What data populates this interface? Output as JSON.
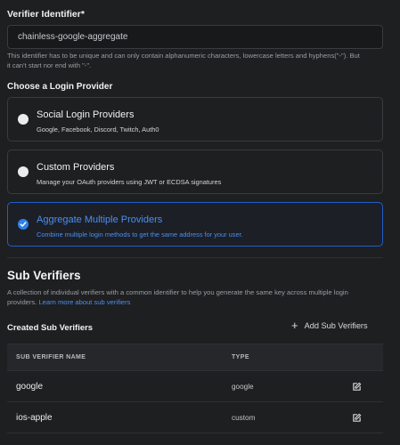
{
  "identifier": {
    "label": "Verifier Identifier*",
    "value": "chainless-google-aggregate",
    "help_line1": "This identifier has to be unique and can only contain alphanumeric characters, lowercase letters and hyphens(\"-\"). But",
    "help_line2": "it can't start nor end with \"-\"."
  },
  "login_provider": {
    "heading": "Choose a Login Provider",
    "options": [
      {
        "title": "Social Login Providers",
        "subtitle": "Google, Facebook, Discord, Twitch, Auth0",
        "selected": false
      },
      {
        "title": "Custom Providers",
        "subtitle": "Manage your OAuth providers using JWT or ECDSA signatures",
        "selected": false
      },
      {
        "title": "Aggregate Multiple Providers",
        "subtitle": "Combine multiple login methods to get the same address for your user.",
        "selected": true
      }
    ]
  },
  "sub_verifiers": {
    "title": "Sub Verifiers",
    "desc_line1": "A collection of individual verifiers with a common identifier to help you generate the same key across multiple login",
    "desc_line2_prefix": "providers. ",
    "learn_more": "Learn more about sub verifiers",
    "created_label": "Created Sub Verifiers",
    "add_label": "Add Sub Verifiers",
    "columns": [
      "SUB VERIFIER NAME",
      "TYPE"
    ],
    "rows": [
      {
        "name": "google",
        "type": "google"
      },
      {
        "name": "ios-apple",
        "type": "custom"
      }
    ]
  },
  "colors": {
    "accent": "#2f80ed",
    "background": "#1e1f21",
    "border": "#3a3b3e"
  }
}
